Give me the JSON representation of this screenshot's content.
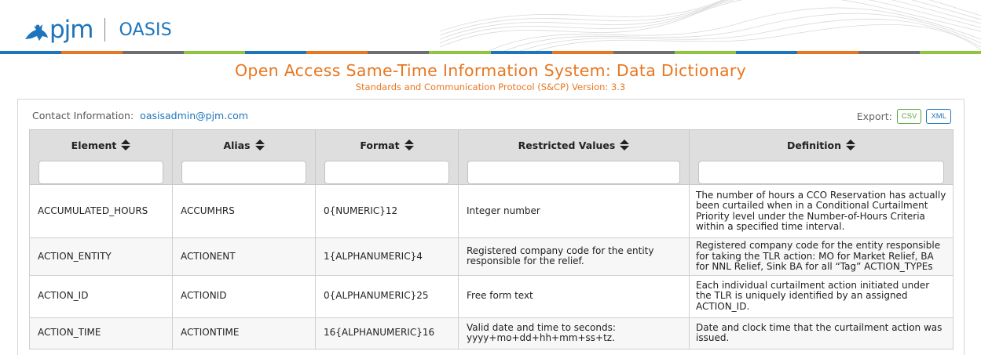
{
  "header": {
    "logo_text": "pjm",
    "app_name": "OASIS"
  },
  "colors": {
    "accent_orange": "#e87722",
    "brand_blue": "#1e75bc",
    "csv_green": "#5aa33b",
    "stripe": [
      "#1e75bc",
      "#e87722",
      "#6d6e71",
      "#8ec63f",
      "#1e75bc",
      "#e87722",
      "#6d6e71",
      "#8ec63f",
      "#1e75bc",
      "#e87722",
      "#6d6e71",
      "#8ec63f",
      "#1e75bc",
      "#e87722",
      "#6d6e71",
      "#8ec63f"
    ]
  },
  "titles": {
    "main": "Open Access Same-Time Information System: Data Dictionary",
    "sub": "Standards and Communication Protocol (S&CP) Version: 3.3"
  },
  "contact": {
    "label": "Contact Information:",
    "email": "oasisadmin@pjm.com"
  },
  "export": {
    "label": "Export:",
    "csv": "CSV",
    "xml": "XML"
  },
  "table": {
    "columns": [
      {
        "label": "Element",
        "sort_icon": "sort-icon",
        "filter_value": ""
      },
      {
        "label": "Alias",
        "sort_icon": "sort-icon",
        "filter_value": ""
      },
      {
        "label": "Format",
        "sort_icon": "sort-icon",
        "filter_value": ""
      },
      {
        "label": "Restricted Values",
        "sort_icon": "sort-icon",
        "filter_value": ""
      },
      {
        "label": "Definition",
        "sort_icon": "sort-icon",
        "filter_value": ""
      }
    ],
    "rows": [
      {
        "element": "ACCUMULATED_HOURS",
        "alias": "ACCUMHRS",
        "format": "0{NUMERIC}12",
        "restricted": "Integer number",
        "definition": "The number of hours a CCO Reservation has actually been curtailed when in a Conditional Curtailment Priority level under the Number-of-Hours Criteria within a specified time interval."
      },
      {
        "element": "ACTION_ENTITY",
        "alias": "ACTIONENT",
        "format": "1{ALPHANUMERIC}4",
        "restricted": "Registered company code for the entity responsible for the relief.",
        "definition": "Registered company code for the entity responsible for taking the TLR action: MO for Market Relief, BA for NNL Relief, Sink BA for all “Tag” ACTION_TYPEs"
      },
      {
        "element": "ACTION_ID",
        "alias": "ACTIONID",
        "format": "0{ALPHANUMERIC}25",
        "restricted": "Free form text",
        "definition": "Each individual curtailment action initiated under the TLR is uniquely identified by an assigned ACTION_ID."
      },
      {
        "element": "ACTION_TIME",
        "alias": "ACTIONTIME",
        "format": "16{ALPHANUMERIC}16",
        "restricted": "Valid date and time to seconds: yyyy+mo+dd+hh+mm+ss+tz.",
        "definition": "Date and clock time that the curtailment action was issued."
      }
    ]
  }
}
